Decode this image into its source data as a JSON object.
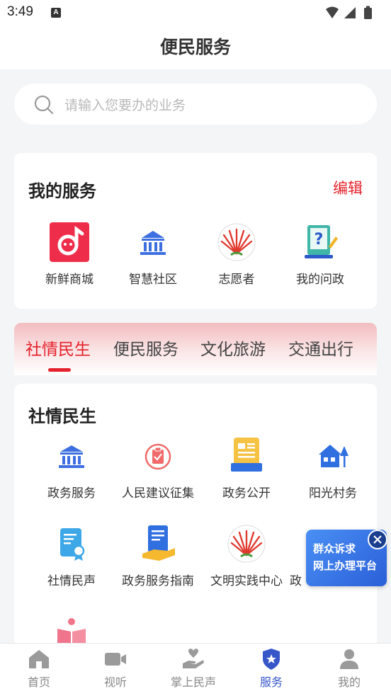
{
  "status_bar": {
    "time": "3:49",
    "notification_badge": "A"
  },
  "header": {
    "title": "便民服务"
  },
  "search": {
    "placeholder": "请输入您要办的业务"
  },
  "my_services": {
    "title": "我的服务",
    "edit_label": "编辑",
    "items": [
      {
        "label": "新鲜商城",
        "icon": "mall-icon"
      },
      {
        "label": "智慧社区",
        "icon": "community-building-icon"
      },
      {
        "label": "志愿者",
        "icon": "volunteer-icon"
      },
      {
        "label": "我的问政",
        "icon": "inquiry-icon"
      }
    ]
  },
  "category_tabs": [
    {
      "label": "社情民生",
      "active": true
    },
    {
      "label": "便民服务",
      "active": false
    },
    {
      "label": "文化旅游",
      "active": false
    },
    {
      "label": "交通出行",
      "active": false
    }
  ],
  "category": {
    "title": "社情民生",
    "items": [
      {
        "label": "政务服务",
        "icon": "government-building-icon"
      },
      {
        "label": "人民建议征集",
        "icon": "suggestion-clipboard-icon"
      },
      {
        "label": "政务公开",
        "icon": "open-affairs-icon"
      },
      {
        "label": "阳光村务",
        "icon": "village-house-icon"
      },
      {
        "label": "社情民声",
        "icon": "certificate-doc-icon"
      },
      {
        "label": "政务服务指南",
        "icon": "guide-doc-hand-icon"
      },
      {
        "label": "文明实践中心",
        "icon": "civilization-icon"
      },
      {
        "label": "政",
        "icon": "partial-icon"
      }
    ]
  },
  "floating_banner": {
    "line1": "群众诉求",
    "line2": "网上办理平台"
  },
  "tabbar": {
    "items": [
      {
        "label": "首页",
        "icon": "home-icon",
        "active": false
      },
      {
        "label": "视听",
        "icon": "video-icon",
        "active": false
      },
      {
        "label": "掌上民声",
        "icon": "heart-hand-icon",
        "active": false
      },
      {
        "label": "服务",
        "icon": "service-shield-icon",
        "active": true
      },
      {
        "label": "我的",
        "icon": "user-icon",
        "active": false
      }
    ]
  },
  "colors": {
    "accent_red": "#e5212b",
    "accent_blue": "#3757c9"
  }
}
